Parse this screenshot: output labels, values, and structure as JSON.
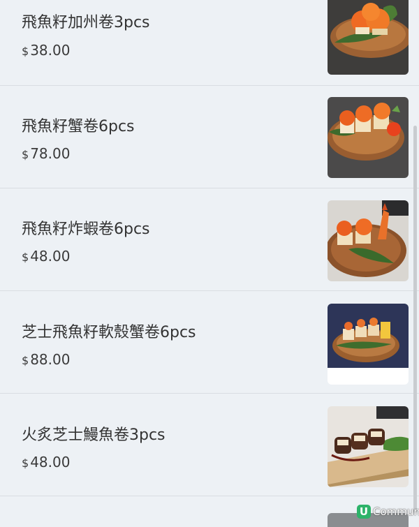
{
  "currency_symbol": "$",
  "items": [
    {
      "name": "飛魚籽加州卷3pcs",
      "price": "38.00"
    },
    {
      "name": "飛魚籽蟹卷6pcs",
      "price": "78.00"
    },
    {
      "name": "飛魚籽炸蝦卷6pcs",
      "price": "48.00"
    },
    {
      "name": "芝士飛魚籽軟殼蟹卷6pcs",
      "price": "88.00"
    },
    {
      "name": "火炙芝士鰻魚卷3pcs",
      "price": "48.00"
    }
  ],
  "watermark": {
    "logo": "U",
    "text": "Community"
  }
}
